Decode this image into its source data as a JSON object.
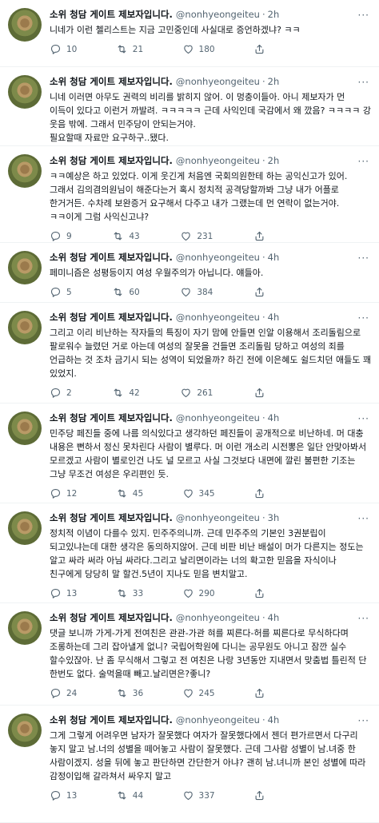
{
  "tweets": [
    {
      "name": "소위 청담 게이트 제보자입니다.",
      "handle": "@nonhyeongeiteu",
      "time": "2h",
      "text": "니네가 이런 첼리스트는 지금 고민중인데 사실대로 증언하겠냐? ㅋㅋ",
      "replies": "10",
      "retweets": "21",
      "likes": "180"
    },
    {
      "name": "소위 청담 게이트 제보자입니다.",
      "handle": "@nonhyeongeiteu",
      "time": "2h",
      "text": "니네 이러면 아무도 권력의 비리를 밝히지 않어. 이 멍충이들아. 아니 제보자가 먼 이득이 있다고 이런거 까발려. ㅋㅋㅋㅋㅋ 근데 사익인데 국감에서 왜 깠음? ㅋㅋㅋㅋ 강 웃음 밖에. 그래서 민주당이 안되는거야.\n필요할때 자료만 요구하구..됐다.",
      "replies": "13",
      "retweets": "36",
      "likes": "198"
    },
    {
      "name": "소위 청담 게이트 제보자입니다.",
      "handle": "@nonhyeongeiteu",
      "time": "2h",
      "text": "ㅋㅋ예상은 하고 있었다. 이게 웃긴게 처음엔 국회의원한테 하는 공익신고가 있어. 그래서 김의겸의원님이 해준다는거 혹시 정치적 공격당할까봐 그냥 내가 어플로 한거거든. 수차례 보완증거 요구해서 다주고 내가 그랬는데 먼 연락이 없는거야. ㅋㅋ이게 그럼 사익신고냐?",
      "replies": "9",
      "retweets": "43",
      "likes": "231"
    },
    {
      "name": "소위 청담 게이트 제보자입니다.",
      "handle": "@nonhyeongeiteu",
      "time": "4h",
      "text": "페미니즘은 성평등이지 여성 우월주의가 아닙니다. 얘들아.",
      "replies": "5",
      "retweets": "60",
      "likes": "384"
    },
    {
      "name": "소위 청담 게이트 제보자입니다.",
      "handle": "@nonhyeongeiteu",
      "time": "4h",
      "text": "그리고 이리 비난하는 작자들의 특징이 자기 맘에 안들면 인알 이용해서 조리돌림으로 팔로워수 늘렸던 거로 아는데 여성의 잘못을 건들면 조리돌림 당하고 여성의 죄를 언급하는 것 조차 금기시 되는 성역이 되었을까? 하긴 전에 이은혜도 쉴드치던 애들도 꽤 있었지.",
      "replies": "2",
      "retweets": "42",
      "likes": "261"
    },
    {
      "name": "소위 청담 게이트 제보자입니다.",
      "handle": "@nonhyeongeiteu",
      "time": "4h",
      "text": "민주당 페진들 중에 나름 의식있다고 생각하던 페진들이 공개적으로 비난하네. 머 대충 내용은 뻔하서 정신 못차린다 사람이 별루다. 머 이런 개소리 시전뽕은 일단 안맞아봐서 모르겠고 사람이 별로인건 나도 널 모르고 사실 그것보다 내면에 깔린 불편한 기조는 그냥 무조건 여성은 우리편인 듯.",
      "replies": "12",
      "retweets": "45",
      "likes": "345"
    },
    {
      "name": "소위 청담 게이트 제보자입니다.",
      "handle": "@nonhyeongeiteu",
      "time": "3h",
      "text": "정치적 이념이 다를수 있지. 민주주의니까. 근데 민주주의 기본인 3권분립이 되고있냐는데 대한 생각은 동의하지않어. 근데 비판 비난 배설이 머가 다른지는 정도는 알고 싸라 써라 아님 싸라다.그리고 날리면이라는 너의 확고한 믿음을 자식이나 친구에게 당당히 말 할건.5년이 지나도 믿음 변치말고.",
      "replies": "13",
      "retweets": "33",
      "likes": "290"
    },
    {
      "name": "소위 청담 게이트 제보자입니다.",
      "handle": "@nonhyeongeiteu",
      "time": "4h",
      "text": "댓글 보니까 가게-가게 전여친은 관관-가관 혀를 찌른다-허를 찌른다로 무식하다며 조롱하는데 그리 잡아낼게 없니? 국립어학원에 다니는 공무원도 아니고 잠깐 실수 할수있잖아. 난 좀 무식해서 그렇고 전 여친은 나랑 3년동안 지내면서 맞춤법 틀린적 단 한번도 없다. 술먹을때 빼고.날리면은?좋니?",
      "replies": "24",
      "retweets": "36",
      "likes": "245"
    },
    {
      "name": "소위 청담 게이트 제보자입니다.",
      "handle": "@nonhyeongeiteu",
      "time": "4h",
      "text": "그게 그렇게 어려우면 남자가 잘못했다 여자가 잘못했다에서 젠더 편가르면서 다구리 놓지 말고 남.너의 성별을 떼어놓고 사람이 잘못했다. 근데 그사람 성별이 남.녀중 한 사람이겠지. 성을 뒤에 놓고 판단하면 간단한거 아냐? 괜히 남.녀니까 본인 성별에 따라 감정이입해 갈라쳐서 싸우지 말고",
      "replies": "13",
      "retweets": "44",
      "likes": "337"
    }
  ],
  "icons": {
    "reply": "reply-icon",
    "retweet": "retweet-icon",
    "like": "heart-icon",
    "share": "share-icon",
    "more": "more-icon"
  },
  "colors": {
    "text": "#0f1419",
    "secondary": "#536471",
    "divider": "#eff3f4"
  }
}
